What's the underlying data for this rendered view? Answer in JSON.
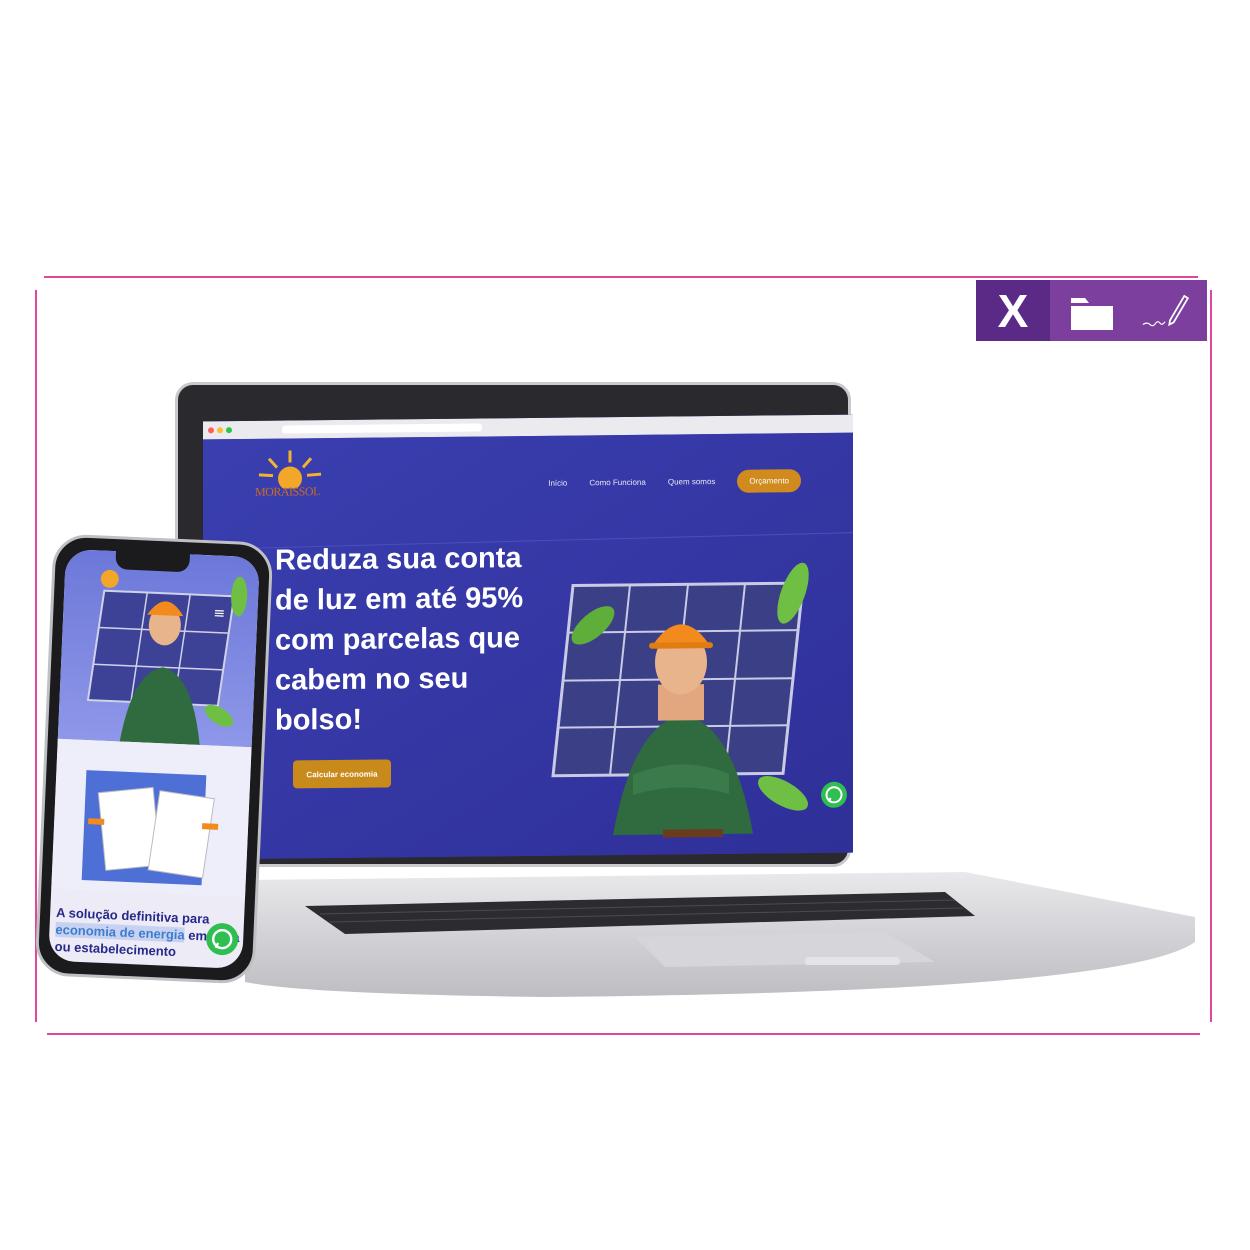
{
  "toolbar": {
    "close_label": "X",
    "icons": [
      "folder-icon",
      "pen-signature-icon"
    ],
    "colors": {
      "close_bg": "#5b2a86",
      "bar_bg": "#7c3f9e"
    }
  },
  "laptop_site": {
    "brand": "MORAISSOL",
    "nav": [
      "Início",
      "Como Funciona",
      "Quem somos"
    ],
    "nav_cta": "Orçamento",
    "hero_title": "Reduza sua conta de luz em até 95% com parcelas que cabem no seu bolso!",
    "hero_button": "Calcular economia",
    "colors": {
      "hero_bg": "#3637a8",
      "accent": "#d08a1e"
    }
  },
  "phone_site": {
    "headline_part1": "A solução definitiva para",
    "headline_highlight": "economia de energia",
    "headline_part2": "em casa ou estabelecimento"
  }
}
